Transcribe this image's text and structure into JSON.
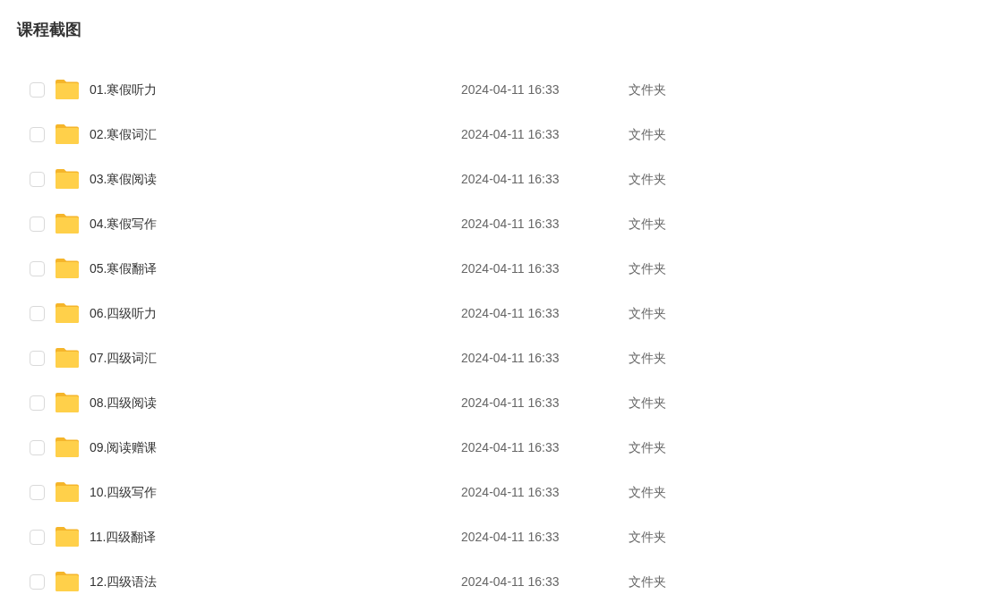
{
  "title": "课程截图",
  "files": [
    {
      "kind": "folder",
      "name": "01.寒假听力",
      "modified": "2024-04-11 16:33",
      "type": "文件夹",
      "checked": false
    },
    {
      "kind": "folder",
      "name": "02.寒假词汇",
      "modified": "2024-04-11 16:33",
      "type": "文件夹",
      "checked": false
    },
    {
      "kind": "folder",
      "name": "03.寒假阅读",
      "modified": "2024-04-11 16:33",
      "type": "文件夹",
      "checked": false
    },
    {
      "kind": "folder",
      "name": "04.寒假写作",
      "modified": "2024-04-11 16:33",
      "type": "文件夹",
      "checked": false
    },
    {
      "kind": "folder",
      "name": "05.寒假翻译",
      "modified": "2024-04-11 16:33",
      "type": "文件夹",
      "checked": false
    },
    {
      "kind": "folder",
      "name": "06.四级听力",
      "modified": "2024-04-11 16:33",
      "type": "文件夹",
      "checked": false
    },
    {
      "kind": "folder",
      "name": "07.四级词汇",
      "modified": "2024-04-11 16:33",
      "type": "文件夹",
      "checked": false
    },
    {
      "kind": "folder",
      "name": "08.四级阅读",
      "modified": "2024-04-11 16:33",
      "type": "文件夹",
      "checked": false
    },
    {
      "kind": "folder",
      "name": "09.阅读赠课",
      "modified": "2024-04-11 16:33",
      "type": "文件夹",
      "checked": false
    },
    {
      "kind": "folder",
      "name": "10.四级写作",
      "modified": "2024-04-11 16:33",
      "type": "文件夹",
      "checked": false
    },
    {
      "kind": "folder",
      "name": "11.四级翻译",
      "modified": "2024-04-11 16:33",
      "type": "文件夹",
      "checked": false
    },
    {
      "kind": "folder",
      "name": "12.四级语法",
      "modified": "2024-04-11 16:33",
      "type": "文件夹",
      "checked": false
    }
  ]
}
